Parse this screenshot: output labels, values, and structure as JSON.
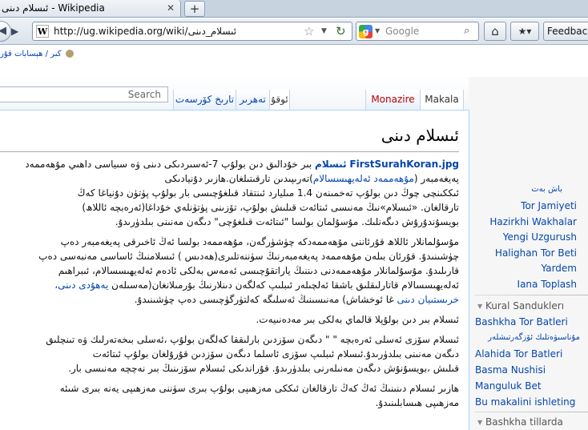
{
  "browser": {
    "tab_title": "ئىسلام دىنى - Wikipedia",
    "tab_close": "✕",
    "new_tab": "+",
    "url": "http://ug.wikipedia.org/wiki/ئىسلام_دىنى",
    "site_icon": "W",
    "search_placeholder": "Google",
    "search_engine_letter": "g",
    "feedback_label": "Feedback"
  },
  "user_links": "كىر / ھېسابات قۇر",
  "search": {
    "placeholder": "Search"
  },
  "tabs": {
    "history": "تارىخ كۆرسەت",
    "edit": "تەھرىر",
    "read": "ئوقۇ",
    "discussion": "Monazire",
    "article": "Makala"
  },
  "article": {
    "title": "ئىسلام دىنى",
    "p1_l1_link": "FirstSurahKoran.jpg",
    "p1_l1_bold": "ئىسلام",
    "p1_l1_text": "بىر خۇدالىق دىن بولۇپ 7-ئەسىردىكى دىنى ۋە سىياسى داھىي مۇھەممەد",
    "p1_l2_text": "پەيغەمبەر (",
    "p1_l2_link": "مۇھەممەد ئەلەيھىسسالام",
    "p1_l2_text2": ")تەرىپىدىن تارقىتىلغان.ھازىر دۇنيادىكى",
    "p1_l3": "ئىككىنچى چوڭ دىن بولۇپ تەخمىنەن 1.4 مىليارد ئىنتقاد قىلغۇچىسى بار بولۇپ پۈتۈن دۇنياغا كەڭ",
    "p1_l4": "تارقالغان. «ئىسلام»نىڭ مەنىسى ئىتائەت قىلىش بولۇپ، تۆزىنى پۈتۈنلەي خۇداغا(ئەرەبچە ئاللاھ)",
    "p1_l5": "بويسۇندۇرۇش دىگەنلىك. مۇسۇلمان بولسا \"ئىتائەت قىلغۇچى\" دىگەن مەنىنى بىلدۈرىدۇ.",
    "p2_l1": "مۇسۇلمانلار ئاللاھ قۇرئاننى مۇھەممەدكە چۈشۈرگەن، مۇھەممەد بولسا ئەڭ ئاخىرقى پەيغەمبەر دەپ",
    "p2_l2": "چۈشىنىدۇ. قۇرئان بىلەن مۇھەممەد پەيغەمبەرنىڭ سۈننەتلىرى(ھەدىس ) ئىسلامنىڭ ئاساسى مەنبەسى دەپ",
    "p2_l3": "قارىلىدۇ. مۇسۇلمانلار مۇھەممەدنى دىننىڭ ياراتقۇچىسى ئەمەس بەلكى ئادەم ئەلەيھىسسالام، ئىبراھىم",
    "p2_l4_text": "ئەلەيھىسسالام قاتارلىقلىق باشقا ئەلچىلەر ئىبلىپ كەلگەن دىنلارنىڭ بۇرمىلانغان(مەسىلەن",
    "p2_l4_link": "يەھۇدى دىنى،",
    "p2_l5_link": "خرىستىيان دىنى",
    "p2_l5_text": "غا ئوخشاش) مەنىسىنىڭ ئەسلىگە كەلتۈرگۈچىسى دەپ چۈشىنىدۇ.",
    "p3_l1": "ئىسلام بىر دىن بولۇپلا قالماي بەلكى بىر مەدەنىيەت.",
    "p4_l1": "ئىسلام سۆزى ئەسلى ئەرەبچە \" \" دىگەن سۆزدىن بارلىققا كەلگەن بولۇپ ،ئەسلى بىخەتەرلىك ۋە تىنچلىق",
    "p4_l2": "دىگەن مەنىنى بىلدۈرىدۇ.ئىسلام ئىبلىپ سۆزى ئاسلما دىگەن سۆزدىن قۇرۇلغان بولۇپ ئىتائەت",
    "p4_l3": "قىلىش ،بويسۇنۇش دىگەن مەنىلەرنى بىلدۈرىدۇ. قۇراندىكى ئىسلام سۆزىنىڭ بىر نەچچە مەنىسى بار.",
    "p5_l1": "ھازىر ئىسلام دىنىنىڭ ئەڭ كەڭ تارقالغان ئىككى مەزھىپى بولۇپ بىرى سۈننى مەزھىپى يەنە بىرى شىئە",
    "p5_l2": "مەزھىپى ھىسابلىنىدۇ."
  },
  "portal": {
    "header": "باش بەت",
    "items": [
      "Tor Jamiyeti",
      "Hazirkhi Wakhalar",
      "Yengi Uzgurush",
      "Halighan Tor Beti",
      "Yardem",
      "Iana Toplash"
    ]
  },
  "kural": {
    "header": "Kural Sanduklerı",
    "items": [
      "Bashkha Tor Batleri",
      "مۇناسىۋەتلىك ئۆزگەرتىشلەر",
      "Alahida Tor Batleri",
      "Basma Nushisi",
      "Manguluk Bet",
      "Bu makalini ishleting"
    ]
  },
  "languages": {
    "header": "Bashkha tillarda"
  },
  "colors": {
    "link": "#0645ad",
    "red_link": "#ba0000",
    "border": "#a7d7f9"
  }
}
